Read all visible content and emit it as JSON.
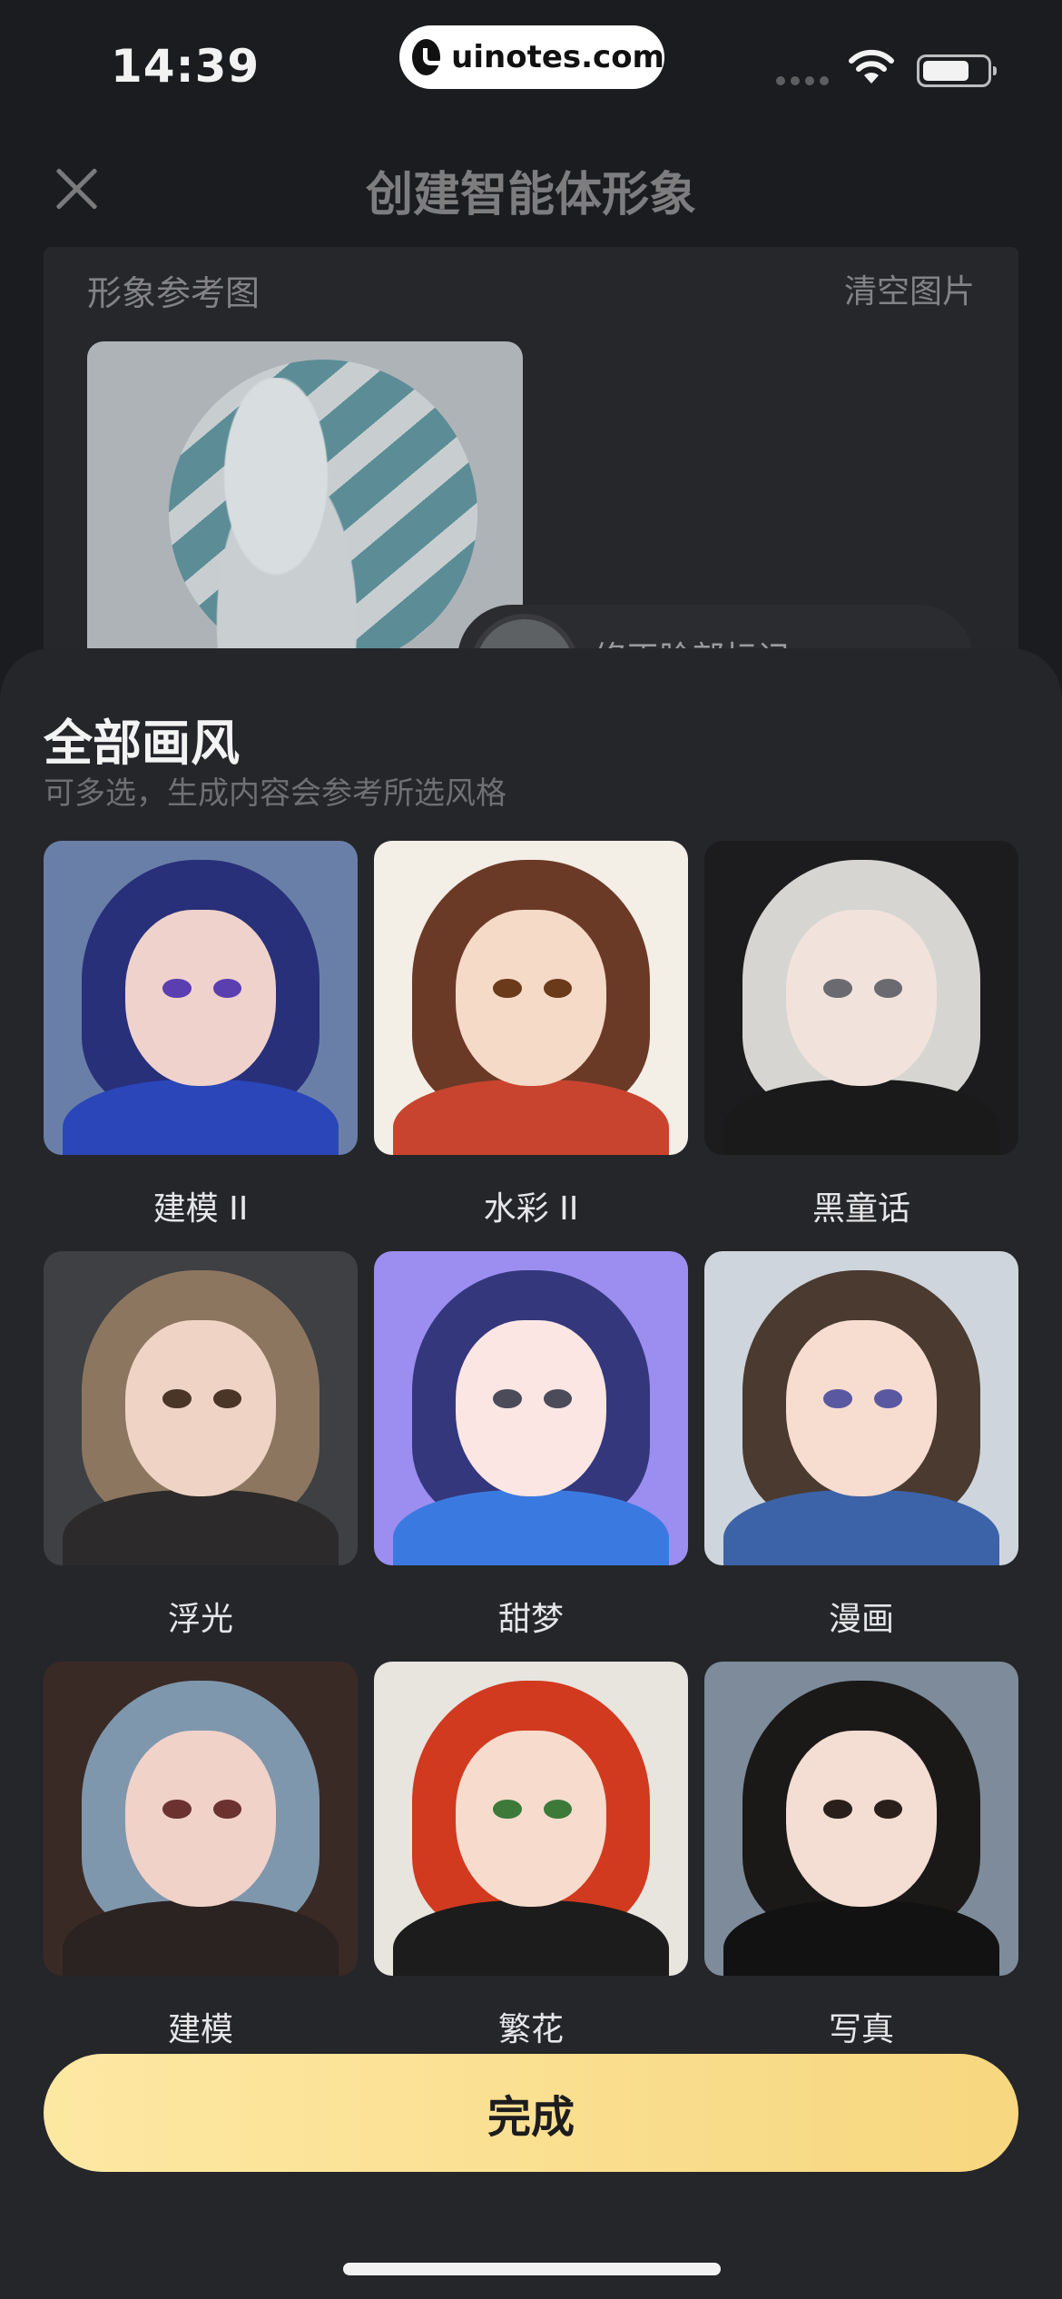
{
  "status_bar": {
    "time": "14:39",
    "watermark": "uinotes.com"
  },
  "header": {
    "title": "创建智能体形象",
    "close_icon": "close-icon"
  },
  "reference": {
    "label": "形象参考图",
    "clear_label": "清空图片",
    "hint_text": "修正脸部标记"
  },
  "sheet": {
    "title": "全部画风",
    "subtitle": "可多选，生成内容会参考所选风格",
    "styles": [
      {
        "label": "建模 II",
        "bg": "#6a7fa8",
        "hair": "#28307a",
        "skin": "#f0d2cc",
        "shirt": "#2a46b8",
        "eye": "#5b3fb0"
      },
      {
        "label": "水彩 II",
        "bg": "#f3eee6",
        "hair": "#6b3a26",
        "skin": "#f6dac8",
        "shirt": "#c8442e",
        "eye": "#6b3a1a"
      },
      {
        "label": "黑童话",
        "bg": "#1c1c1f",
        "hair": "#d6d5d2",
        "skin": "#f1e3dc",
        "shirt": "#1a1a1a",
        "eye": "#6a6a70"
      },
      {
        "label": "浮光",
        "bg": "#3e4044",
        "hair": "#8c7660",
        "skin": "#efd4c6",
        "shirt": "#2c2a2a",
        "eye": "#4b3527"
      },
      {
        "label": "甜梦",
        "bg": "#9c8ef0",
        "hair": "#34377c",
        "skin": "#fbe6e3",
        "shirt": "#3a7ae0",
        "eye": "#4b4b5a"
      },
      {
        "label": "漫画",
        "bg": "#cfd5dd",
        "hair": "#4a3a30",
        "skin": "#f7ddd0",
        "shirt": "#3c63a8",
        "eye": "#5a58a0"
      },
      {
        "label": "建模",
        "bg": "#3a2a25",
        "hair": "#7f97ad",
        "skin": "#f1d2c8",
        "shirt": "#2b2222",
        "eye": "#6b3230"
      },
      {
        "label": "繁花",
        "bg": "#e8e4de",
        "hair": "#d13a1f",
        "skin": "#f7dccd",
        "shirt": "#1c1c1c",
        "eye": "#3d7a3a"
      },
      {
        "label": "写真",
        "bg": "#7d8b9a",
        "hair": "#1b1918",
        "skin": "#f4ddd3",
        "shirt": "#121212",
        "eye": "#2a1f1a"
      }
    ]
  },
  "confirm_button": {
    "label": "完成"
  },
  "colors": {
    "accent": "#f7d77f",
    "background": "#1b1c1f",
    "sheet": "#25262a"
  }
}
